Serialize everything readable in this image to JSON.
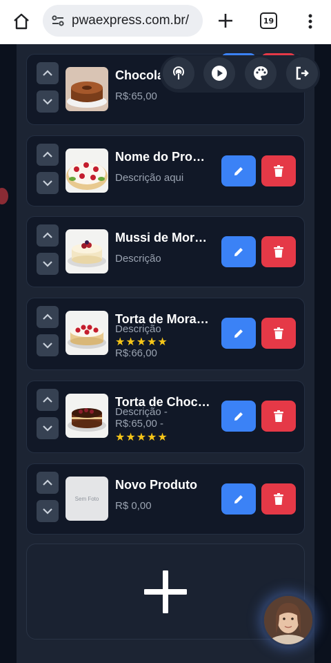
{
  "browser": {
    "url": "pwaexpress.com.br/",
    "tab_count": "19",
    "icons": {
      "home": "home-icon",
      "site_settings": "tune-icon",
      "new_tab": "plus-icon",
      "tabs": "tab-switcher-icon",
      "menu": "kebab-icon"
    }
  },
  "toolbar": {
    "buttons": [
      "podcast-icon",
      "play-icon",
      "palette-icon",
      "logout-icon"
    ]
  },
  "products": [
    {
      "name": "Chocolate",
      "lines": [
        "R$:65,00"
      ],
      "stars": ""
    },
    {
      "name": "Nome do Produto",
      "lines": [
        "Descrição aqui"
      ],
      "stars": ""
    },
    {
      "name": "Mussi de Morango",
      "lines": [
        "Descrição"
      ],
      "stars": ""
    },
    {
      "name": "Torta de Morango",
      "lines": [
        "Descrição",
        "R$:66,00"
      ],
      "stars": "★★★★★"
    },
    {
      "name": "Torta de Chocolate",
      "lines": [
        "Descrição -",
        "R$:65,00 -"
      ],
      "stars": "★★★★★"
    },
    {
      "name": "Novo Produto",
      "lines": [
        "R$ 0,00"
      ],
      "stars": "",
      "no_photo_label": "Sem Foto"
    }
  ],
  "add_button": {
    "icon": "plus-icon"
  },
  "colors": {
    "edit": "#3b82f6",
    "delete": "#e53947",
    "card": "#111827",
    "panel": "#1c2433",
    "star": "#f5c518"
  }
}
